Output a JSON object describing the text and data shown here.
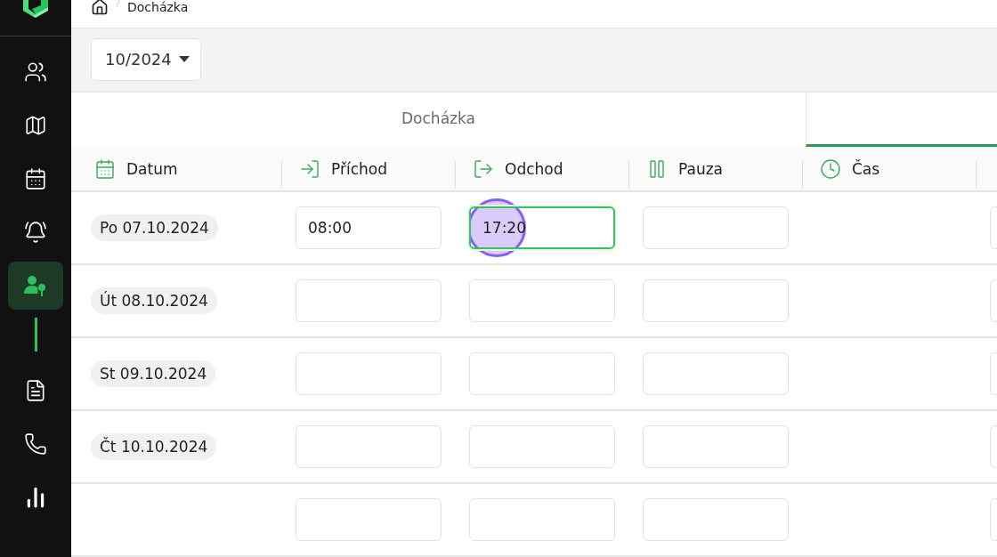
{
  "breadcrumb": {
    "current": "Docházka"
  },
  "sidebar": {
    "items": [
      {
        "kind": "users",
        "selected": false
      },
      {
        "kind": "map",
        "selected": false
      },
      {
        "kind": "calendar",
        "selected": false
      },
      {
        "kind": "bell",
        "selected": false
      },
      {
        "kind": "attendance",
        "selected": true
      },
      {
        "kind": "document",
        "selected": false
      },
      {
        "kind": "phone",
        "selected": false
      },
      {
        "kind": "chart",
        "selected": false
      }
    ]
  },
  "month_picker": {
    "value": "10/2024"
  },
  "tabs": [
    {
      "label": "Docházka",
      "selected": false
    },
    {
      "selected": true
    }
  ],
  "table": {
    "columns": [
      {
        "label": "Datum",
        "kind": "calendar"
      },
      {
        "label": "Příchod",
        "kind": "arrival"
      },
      {
        "label": "Odchod",
        "kind": "departure"
      },
      {
        "label": "Pauza",
        "kind": "pause"
      },
      {
        "label": "Čas",
        "kind": "clock"
      },
      {
        "kind": "partial"
      }
    ],
    "rows": [
      {
        "date": "Po 07.10.2024",
        "fields": [
          {
            "value": "08:00",
            "focused": false,
            "clicked": false
          },
          {
            "value": "17:20",
            "focused": true,
            "clicked": true
          },
          {
            "focused": false,
            "clicked": false
          }
        ]
      },
      {
        "date": "Út 08.10.2024",
        "fields": [
          {
            "focused": false,
            "clicked": false
          },
          {
            "focused": false,
            "clicked": false
          },
          {
            "focused": false,
            "clicked": false
          }
        ]
      },
      {
        "date": "St 09.10.2024",
        "fields": [
          {
            "focused": false,
            "clicked": false
          },
          {
            "focused": false,
            "clicked": false
          },
          {
            "focused": false,
            "clicked": false
          }
        ]
      },
      {
        "date": "Čt 10.10.2024",
        "fields": [
          {
            "focused": false,
            "clicked": false
          },
          {
            "focused": false,
            "clicked": false
          },
          {
            "focused": false,
            "clicked": false
          }
        ]
      },
      {
        "fields": [
          {
            "focused": false,
            "clicked": false
          },
          {
            "focused": false,
            "clicked": false
          },
          {
            "focused": false,
            "clicked": false
          }
        ]
      }
    ]
  }
}
